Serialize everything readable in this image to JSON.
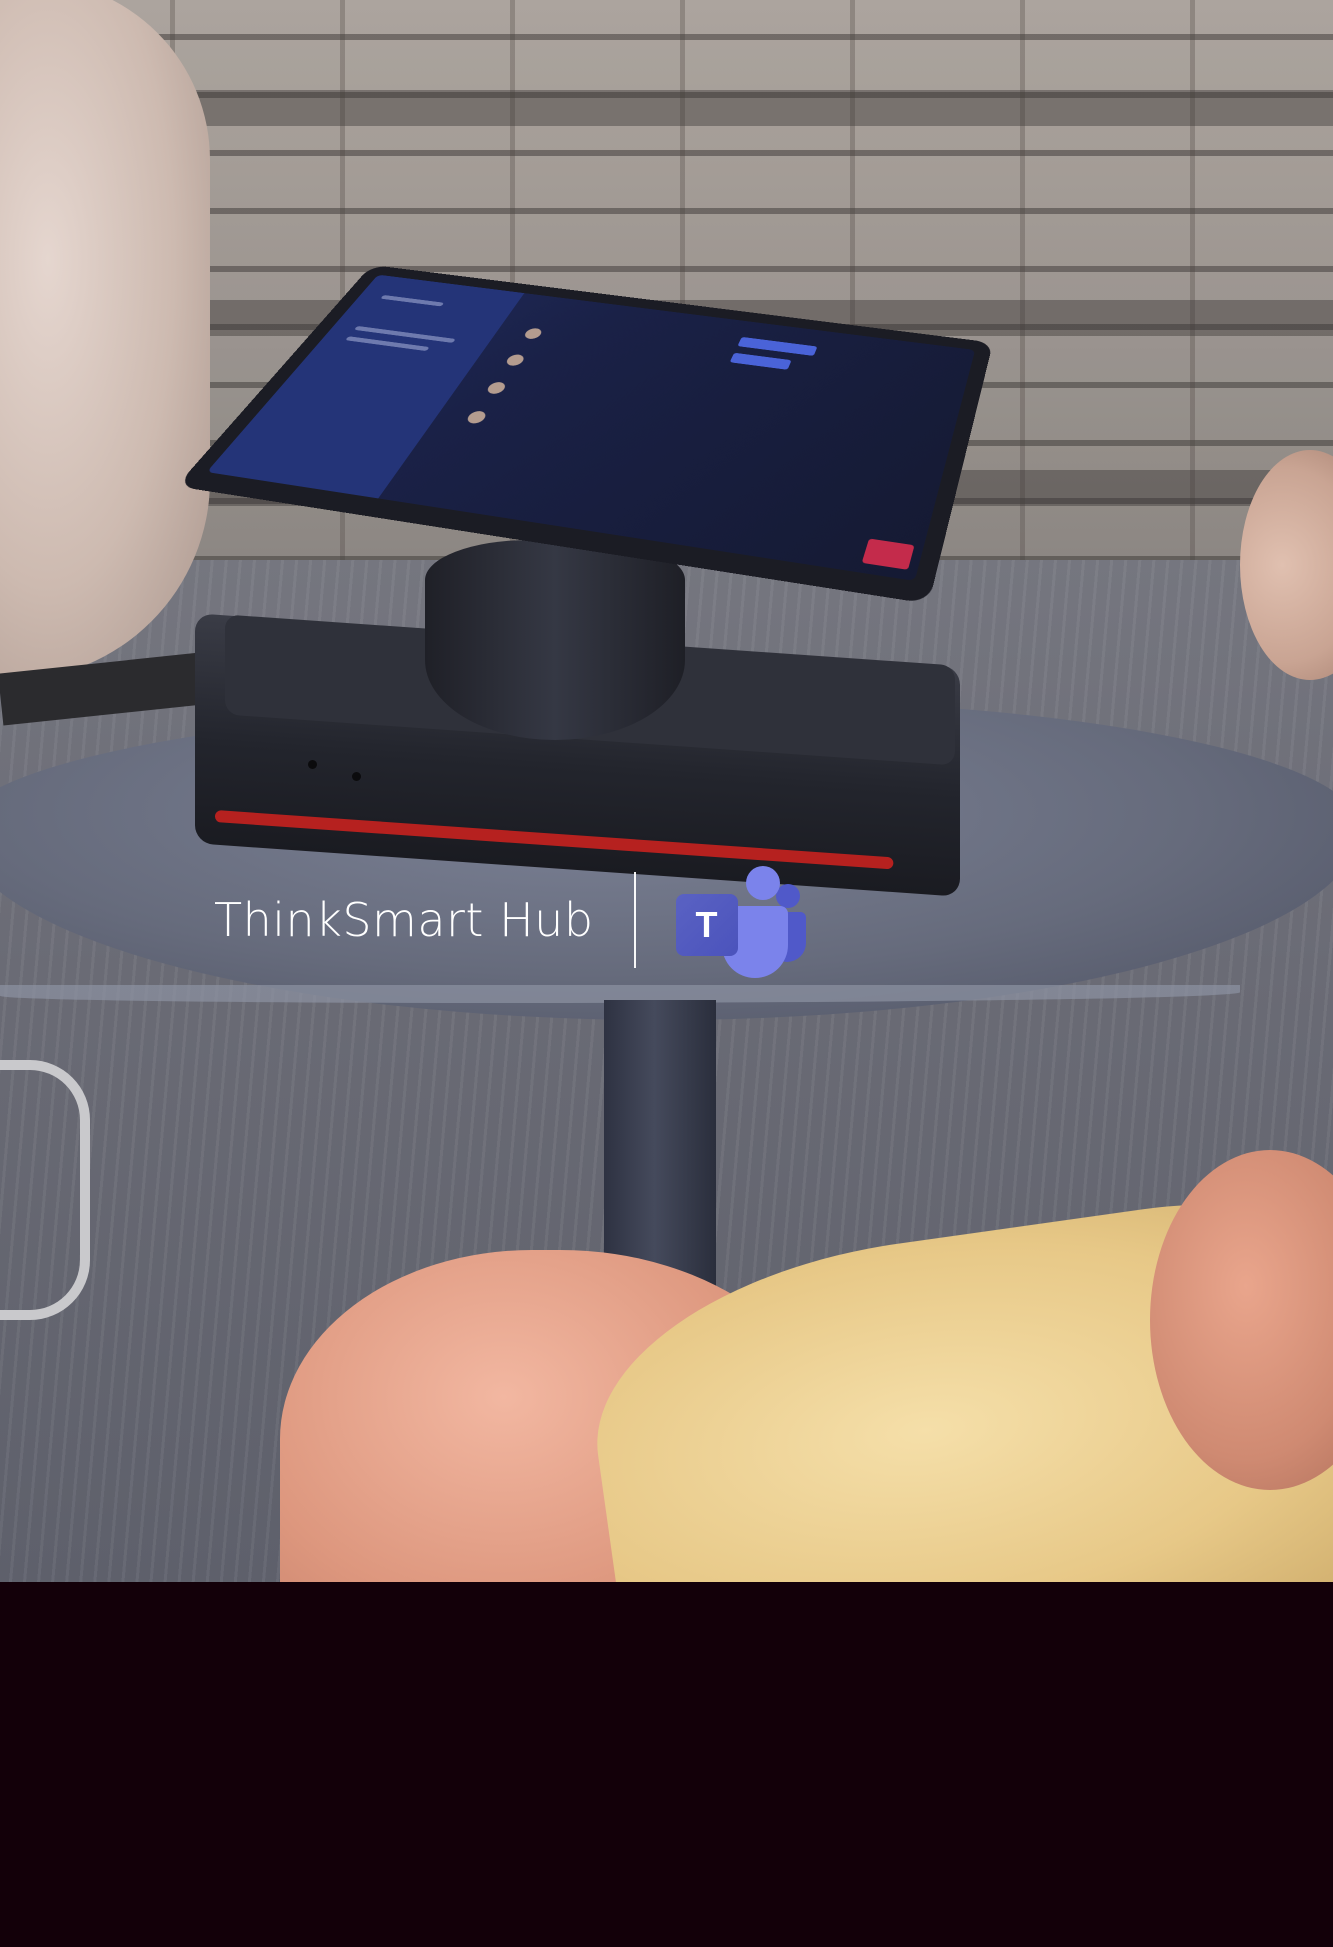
{
  "image": {
    "product_name": "ThinkSmart Hub",
    "logo_letter": "T",
    "logo_icon": "microsoft-teams-icon",
    "colors": {
      "bottom_band": "#130009",
      "teams_primary": "#7b83eb",
      "teams_dark": "#5059c9",
      "text": "#ffffff"
    }
  }
}
